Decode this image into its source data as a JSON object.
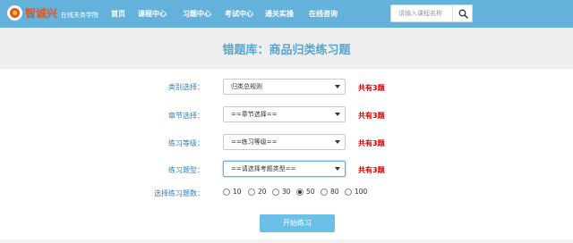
{
  "header": {
    "logo_name": "智诚兴",
    "logo_subtitle": "在线关务学院",
    "nav": [
      {
        "label": "首页"
      },
      {
        "label": "课程中心"
      },
      {
        "label": "习题中心"
      },
      {
        "label": "考试中心"
      },
      {
        "label": "通关实操"
      },
      {
        "label": "在线咨询"
      }
    ],
    "search": {
      "placeholder": "请输入课程名称",
      "icon": "search-icon"
    },
    "colors": {
      "bar": "#64b1dc",
      "logo_accent": "#e8541d"
    }
  },
  "page": {
    "title": "错题库：商品归类练习题",
    "title_color": "#5aa6cf"
  },
  "form": {
    "fields": [
      {
        "label": "类别选择：",
        "value": "归类总规则",
        "count": "共有3题"
      },
      {
        "label": "章节选择：",
        "value": "==章节选择==",
        "count": "共有3题"
      },
      {
        "label": "练习等级：",
        "value": "==练习等级==",
        "count": "共有3题"
      },
      {
        "label": "练习题型：",
        "value": "==请选择考题类型==",
        "count": "共有3题"
      }
    ],
    "quantity": {
      "label": "选择练习题数：",
      "options": [
        "10",
        "20",
        "30",
        "50",
        "80",
        "100"
      ],
      "selected": "50"
    },
    "start_button": "开始练习",
    "colors": {
      "label": "#2e7fc0",
      "count": "#d40000",
      "button": "#6bc0e8"
    }
  }
}
